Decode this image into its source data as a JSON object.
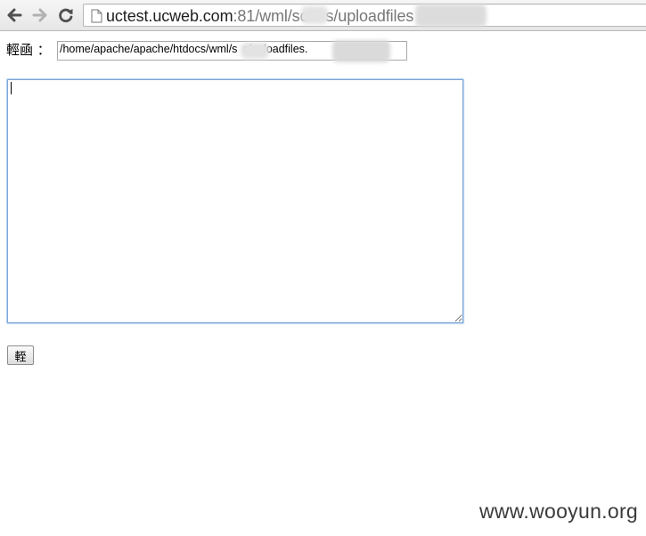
{
  "toolbar": {
    "back_icon": "arrow-left-icon",
    "forward_icon": "arrow-right-icon",
    "reload_icon": "reload-icon",
    "page_icon": "page-icon"
  },
  "address_bar": {
    "host": "uctest.ucweb.com",
    "path_1": ":81/wml/sc",
    "path_2": "s/uploadfiles"
  },
  "form": {
    "label": "輕凾 ：",
    "path_value": "/home/apache/apache/htdocs/wml/s",
    "path_value_2": "s/uploadfiles.",
    "textarea_value": "",
    "submit_label": "輊"
  },
  "watermark": "www.wooyun.org"
}
